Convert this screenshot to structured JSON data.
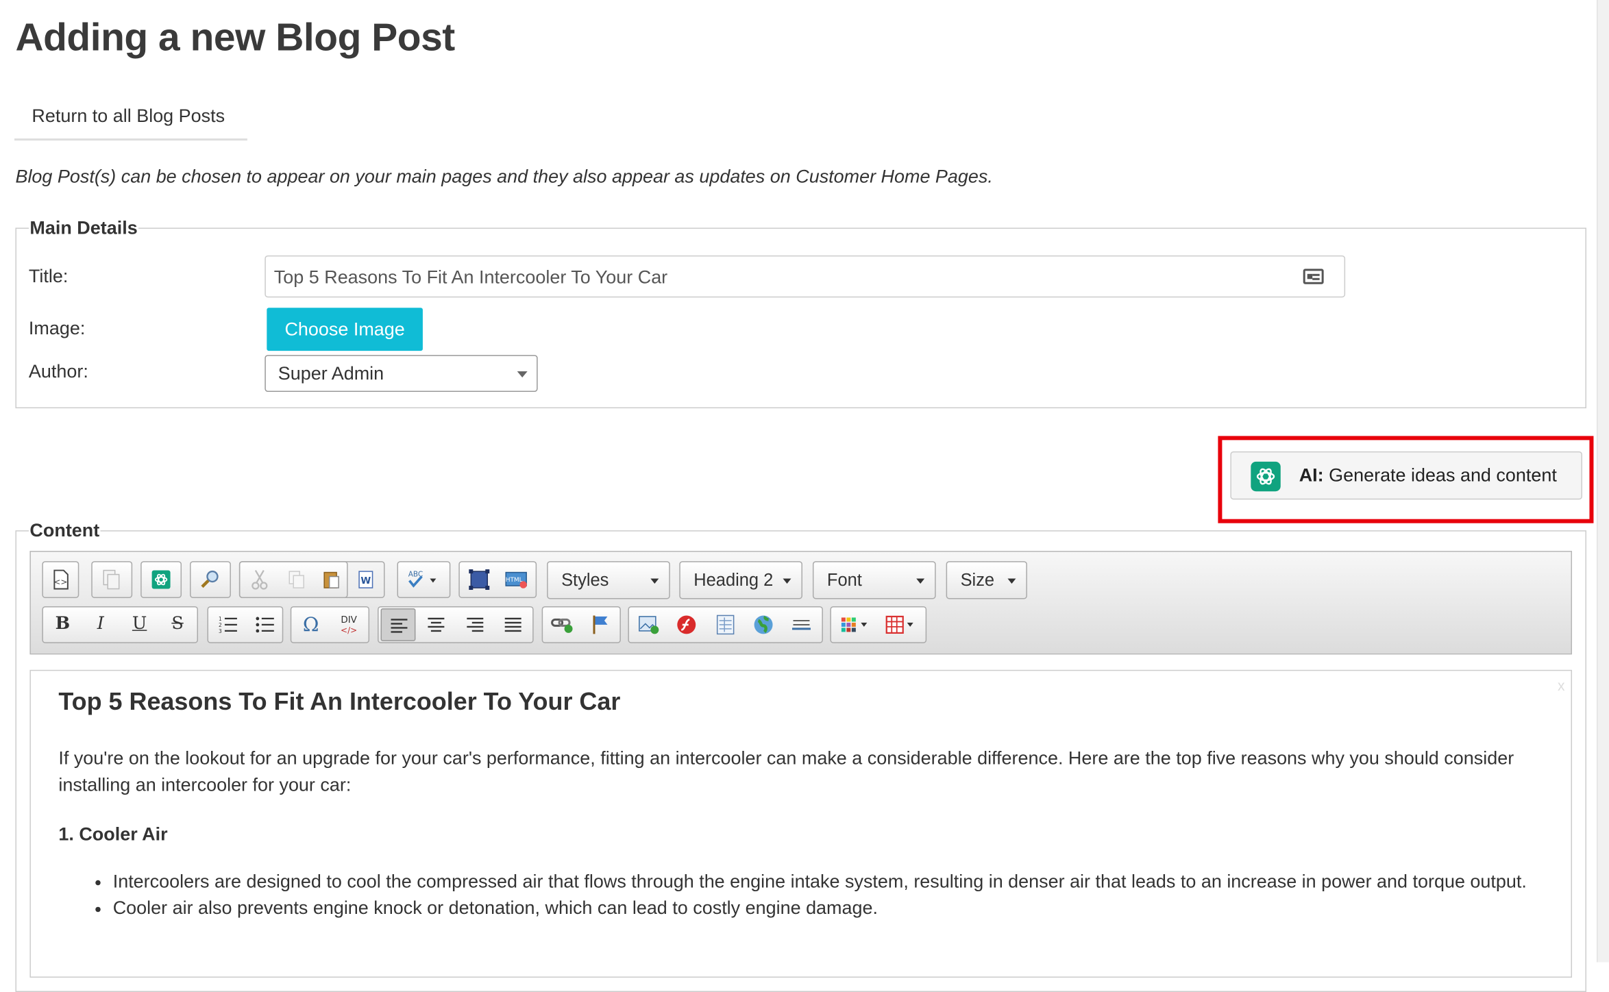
{
  "page": {
    "title": "Adding a new Blog Post",
    "return_link": "Return to all Blog Posts",
    "intro": "Blog Post(s) can be chosen to appear on your main pages and they also appear as updates on Customer Home Pages."
  },
  "main_details": {
    "legend": "Main Details",
    "title_label": "Title:",
    "title_value": "Top 5 Reasons To Fit An Intercooler To Your Car",
    "image_label": "Image:",
    "choose_image": "Choose Image",
    "author_label": "Author:",
    "author_value": "Super Admin"
  },
  "ai_button": {
    "prefix": "AI:",
    "label": "Generate ideas and content",
    "highlight_color": "#e8000b",
    "logo_color": "#10a37f"
  },
  "content": {
    "legend": "Content",
    "toolbar": {
      "styles": "Styles",
      "format": "Heading 2",
      "font": "Font",
      "size": "Size",
      "bold": "B",
      "italic": "I",
      "underline": "U",
      "strike": "S",
      "special_char": "Ω",
      "div": "DIV"
    },
    "editor": {
      "heading": "Top 5 Reasons To Fit An Intercooler To Your Car",
      "paragraph": "If you're on the lookout for an upgrade for your car's performance, fitting an intercooler can make a considerable difference. Here are the top five reasons why you should consider installing an intercooler for your car:",
      "section_heading": "1. Cooler Air",
      "bullets": [
        "Intercoolers are designed to cool the compressed air that flows through the engine intake system, resulting in denser air that leads to an increase in power and torque output.",
        "Cooler air also prevents engine knock or detonation, which can lead to costly engine damage."
      ],
      "close": "x"
    }
  },
  "colors": {
    "choose_button": "#10bcd6"
  }
}
